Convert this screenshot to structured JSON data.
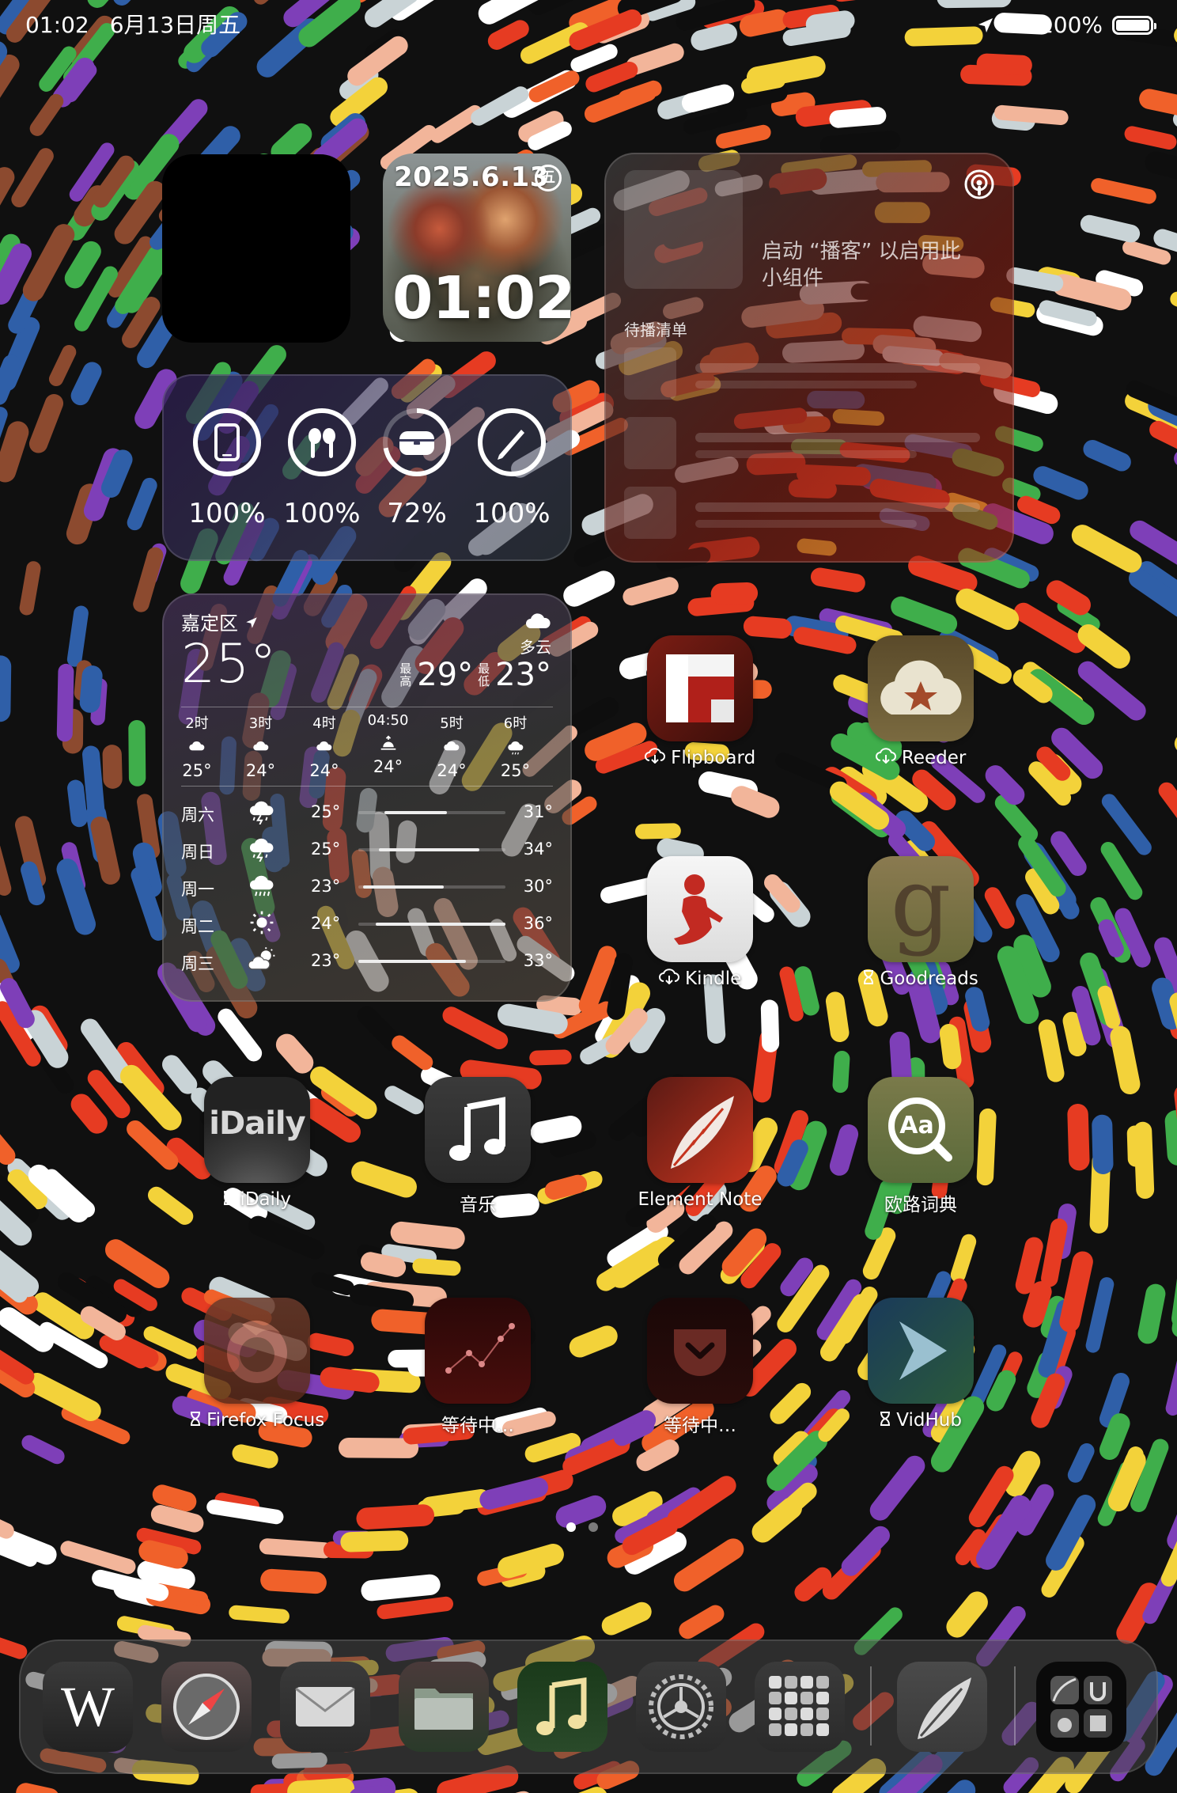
{
  "status_bar": {
    "time": "01:02",
    "date": "6月13日周五",
    "battery": "100%",
    "battery_level": 1.0
  },
  "clock_widget": {
    "date": "2025.6.13",
    "weekday_badge": "五",
    "time": "01:02"
  },
  "podcast_widget": {
    "message": "启动 “播客” 以启用此小组件",
    "queue_label": "待播清单"
  },
  "battery_widget": {
    "items": [
      {
        "device": "ipad-icon",
        "percent_label": "100%",
        "level": 1.0
      },
      {
        "device": "airpods-icon",
        "percent_label": "100%",
        "level": 1.0
      },
      {
        "device": "airpods-case-icon",
        "percent_label": "72%",
        "level": 0.72
      },
      {
        "device": "pencil-icon",
        "percent_label": "100%",
        "level": 1.0
      }
    ]
  },
  "weather_widget": {
    "location": "嘉定区",
    "temperature": "25°",
    "condition": "多云",
    "high_label": "最高",
    "high": "29°",
    "low_label": "最低",
    "low": "23°",
    "hourly": [
      {
        "time": "2时",
        "icon": "cloud-icon",
        "temp": "25°"
      },
      {
        "time": "3时",
        "icon": "cloud-icon",
        "temp": "24°"
      },
      {
        "time": "4时",
        "icon": "cloud-icon",
        "temp": "24°"
      },
      {
        "time": "04:50",
        "icon": "sunrise-icon",
        "temp": "24°"
      },
      {
        "time": "5时",
        "icon": "cloud-icon",
        "temp": "24°"
      },
      {
        "time": "6时",
        "icon": "cloud-drizzle-icon",
        "temp": "25°"
      }
    ],
    "daily": [
      {
        "day": "周六",
        "icon": "thunderstorm-icon",
        "low": "25°",
        "high": "31°",
        "range_start": 0.18,
        "range_end": 0.6
      },
      {
        "day": "周日",
        "icon": "thunderstorm-icon",
        "low": "25°",
        "high": "34°",
        "range_start": 0.14,
        "range_end": 0.82
      },
      {
        "day": "周一",
        "icon": "rain-icon",
        "low": "23°",
        "high": "30°",
        "range_start": 0.03,
        "range_end": 0.58
      },
      {
        "day": "周二",
        "icon": "sun-icon",
        "low": "24°",
        "high": "36°",
        "range_start": 0.12,
        "range_end": 1.0
      },
      {
        "day": "周三",
        "icon": "partly-sunny-icon",
        "low": "23°",
        "high": "33°",
        "range_start": 0.0,
        "range_end": 0.73
      }
    ]
  },
  "apps": {
    "flipboard": {
      "label": "Flipboard",
      "prefix": "cloud-download-icon"
    },
    "reeder": {
      "label": "Reeder",
      "prefix": "cloud-download-icon"
    },
    "kindle": {
      "label": "Kindle",
      "prefix": "cloud-download-icon"
    },
    "goodreads": {
      "label": "Goodreads",
      "prefix": "hourglass-icon",
      "icon_text": "g"
    },
    "idaily": {
      "label": "iDaily",
      "prefix": "hourglass-icon",
      "icon_text": "iDaily"
    },
    "music": {
      "label": "音乐"
    },
    "element_note": {
      "label": "Element Note"
    },
    "eudic": {
      "label": "欧路词典",
      "icon_text": "Aa"
    },
    "firefox_focus": {
      "label": "Firefox Focus",
      "prefix": "hourglass-icon"
    },
    "waiting_1": {
      "label": "等待中…"
    },
    "waiting_2": {
      "label": "等待中…"
    },
    "vidhub": {
      "label": "VidHub",
      "prefix": "hourglass-icon"
    }
  },
  "page_indicator": {
    "pages": 2,
    "current": 1
  },
  "dock": {
    "apps": [
      {
        "name": "wikipedia",
        "icon_text": "W"
      },
      {
        "name": "safari"
      },
      {
        "name": "mail"
      },
      {
        "name": "files"
      },
      {
        "name": "music"
      },
      {
        "name": "settings"
      },
      {
        "name": "app-library-folder"
      },
      {
        "name": "element-note-recent"
      },
      {
        "name": "recent-apps-folder"
      }
    ]
  }
}
